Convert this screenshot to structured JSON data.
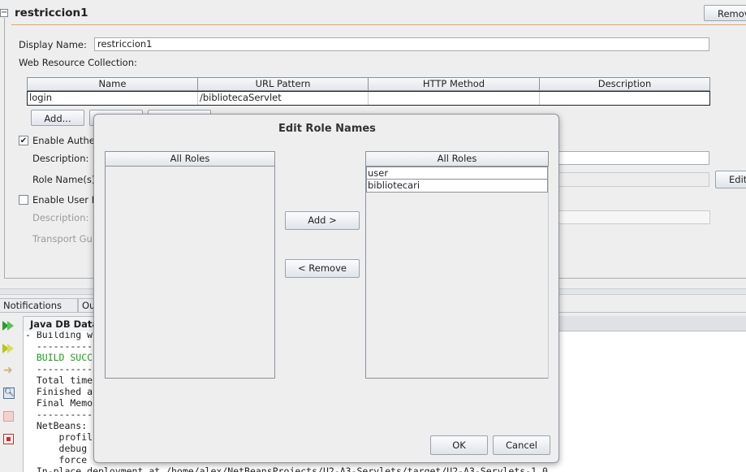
{
  "section": {
    "title": "restriccion1",
    "remove_label": "Remove",
    "collapse_glyph": "⊟"
  },
  "form": {
    "display_name_label": "Display Name:",
    "display_name_value": "restriccion1",
    "web_resource_label": "Web Resource Collection:",
    "table": {
      "columns": [
        "Name",
        "URL Pattern",
        "HTTP Method",
        "Description"
      ],
      "rows": [
        [
          "login",
          "/bibliotecaServlet",
          "",
          ""
        ]
      ]
    },
    "add_label": "Add...",
    "enable_auth_label": "Enable Authe",
    "enable_auth_checked": "✔",
    "description_label": "Description:",
    "role_names_label": "Role Name(s)",
    "edit_label": "Edit",
    "enable_user_label": "Enable User D",
    "description2_label": "Description:",
    "transport_label": "Transport Gu"
  },
  "bottom": {
    "tabs": [
      "Notifications",
      "Ou"
    ],
    "output_tab": "Java DB Data",
    "console_lines": [
      "- Building w",
      "  ----------",
      "  BUILD SUCC",
      "  ----------",
      "  Total time",
      "  Finished a",
      "  Final Memo",
      "  ----------",
      "  NetBeans: ",
      "      profil",
      "      debug ",
      "      force ",
      "  In-place deployment at /home/alex/NetBeansProjects/U2-A3-Servlets/target/U2-A3-Servlets-1.0"
    ],
    "toolbar_icons": [
      "run-again-icon",
      "run-icon",
      "stop-arrow-icon",
      "find-icon",
      "clear-icon",
      "stop-icon"
    ]
  },
  "dialog": {
    "title": "Edit Role Names",
    "left_header": "All Roles",
    "right_header": "All Roles",
    "right_items": [
      "user",
      "bibliotecari"
    ],
    "add_label": "Add >",
    "remove_label": "< Remove",
    "ok_label": "OK",
    "cancel_label": "Cancel"
  }
}
